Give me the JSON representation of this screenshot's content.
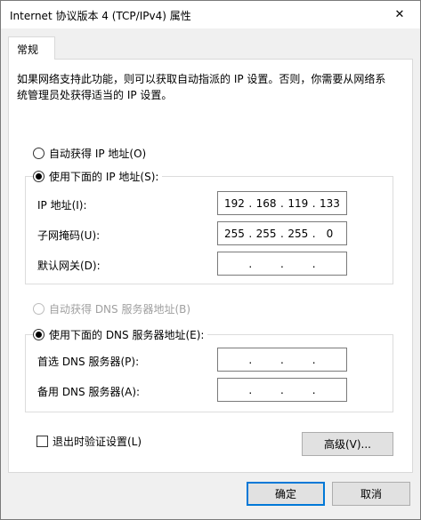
{
  "window": {
    "title": "Internet 协议版本 4 (TCP/IPv4) 属性",
    "close_glyph": "✕"
  },
  "tabs": [
    {
      "label": "常规"
    }
  ],
  "description": "如果网络支持此功能，则可以获取自动指派的 IP 设置。否则，你需要从网络系统管理员处获得适当的 IP 设置。",
  "ip_section": {
    "auto_label": "自动获得 IP 地址(O)",
    "manual_label": "使用下面的 IP 地址(S):",
    "selected": "manual",
    "fields": [
      {
        "label": "IP 地址(I):",
        "octets": [
          "192",
          "168",
          "119",
          "133"
        ]
      },
      {
        "label": "子网掩码(U):",
        "octets": [
          "255",
          "255",
          "255",
          "0"
        ]
      },
      {
        "label": "默认网关(D):",
        "octets": [
          "",
          "",
          "",
          ""
        ]
      }
    ]
  },
  "dns_section": {
    "auto_label": "自动获得 DNS 服务器地址(B)",
    "manual_label": "使用下面的 DNS 服务器地址(E):",
    "selected": "manual",
    "auto_disabled": true,
    "fields": [
      {
        "label": "首选 DNS 服务器(P):",
        "octets": [
          "",
          "",
          "",
          ""
        ]
      },
      {
        "label": "备用 DNS 服务器(A):",
        "octets": [
          "",
          "",
          "",
          ""
        ]
      }
    ]
  },
  "validate_on_exit": {
    "label": "退出时验证设置(L)",
    "checked": false
  },
  "buttons": {
    "advanced": "高级(V)...",
    "ok": "确定",
    "cancel": "取消"
  },
  "colors": {
    "accent": "#0078d7",
    "disabled_text": "#a0a0a0"
  }
}
